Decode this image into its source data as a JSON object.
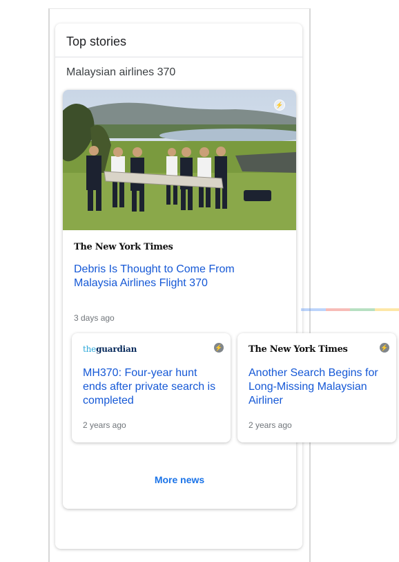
{
  "section": {
    "title": "Top stories"
  },
  "query": "Malaysian airlines 370",
  "main_story": {
    "publisher": "The New York Times",
    "headline": "Debris Is Thought to Come From Malaysia Airlines Flight 370",
    "time": "3 days ago",
    "badge_icon": "amp-lightning-icon"
  },
  "secondary_stories": [
    {
      "publisher_prefix": "the",
      "publisher_name": "guardian",
      "headline": "MH370: Four-year hunt ends after private search is completed",
      "time": "2 years ago",
      "badge_icon": "amp-lightning-icon"
    },
    {
      "publisher": "The New York Times",
      "headline": "Another Search Begins for Long-Missing Malaysian Airliner",
      "time": "2 years ago",
      "badge_icon": "amp-lightning-icon"
    }
  ],
  "more_news_label": "More news",
  "colors": {
    "link": "#1558d6",
    "more_news": "#1a73e8",
    "google_strip": [
      "#4285f4",
      "#ea4335",
      "#34a853",
      "#fbbc05"
    ]
  }
}
